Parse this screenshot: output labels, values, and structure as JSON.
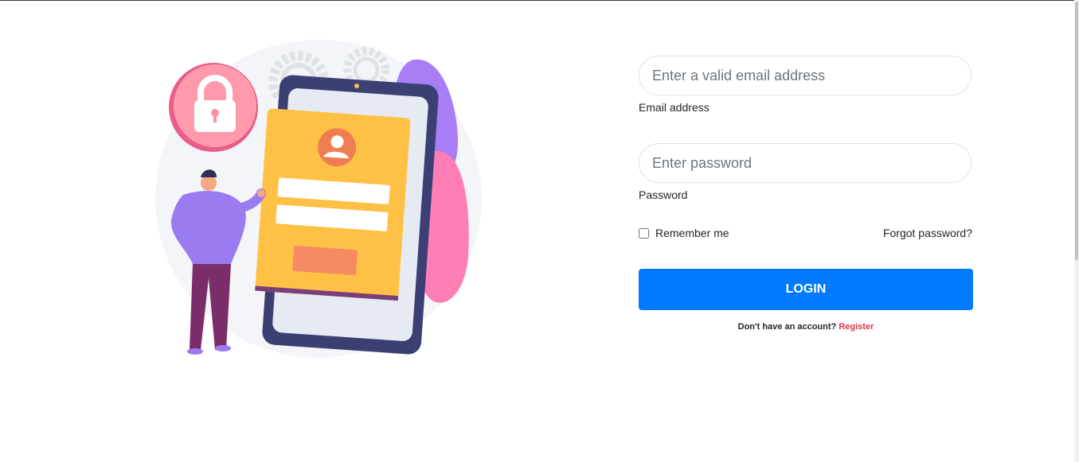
{
  "form": {
    "email": {
      "placeholder": "Enter a valid email address",
      "label": "Email address"
    },
    "password": {
      "placeholder": "Enter password",
      "label": "Password"
    },
    "remember_label": "Remember me",
    "forgot_label": "Forgot password?",
    "login_label": "LOGIN",
    "register_prompt": "Don't have an account?",
    "register_link": "Register"
  },
  "colors": {
    "accent": "#007bff",
    "register_link": "#dc3545",
    "illustration_card": "#ffc145",
    "illustration_lock": "#ff8fa3",
    "illustration_person": "#9b7bf0"
  },
  "icons": [
    "gear-icon",
    "lock-icon",
    "user-avatar-icon"
  ]
}
